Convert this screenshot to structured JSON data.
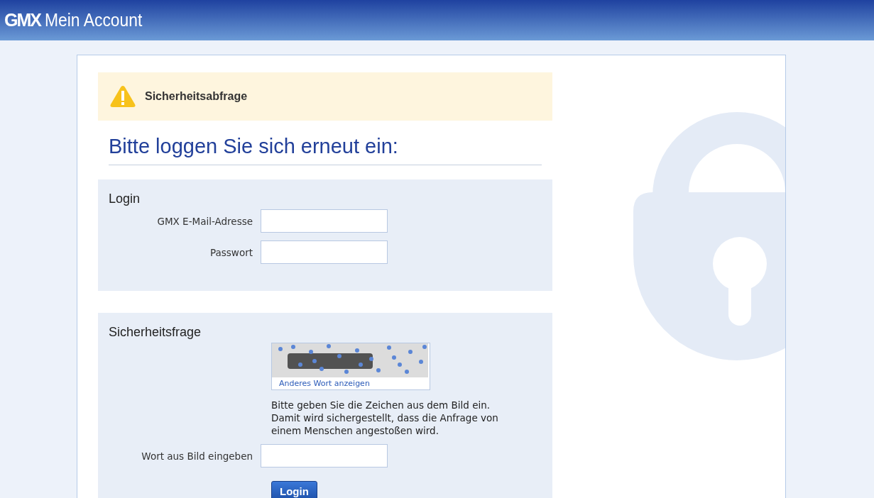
{
  "header": {
    "logo": "GMX",
    "title": "Mein Account"
  },
  "alert": {
    "title": "Sicherheitsabfrage"
  },
  "heading": "Bitte loggen Sie sich erneut ein:",
  "login_section": {
    "title": "Login",
    "fields": [
      {
        "label": "GMX E-Mail-Adresse"
      },
      {
        "label": "Passwort"
      }
    ]
  },
  "security_section": {
    "title": "Sicherheitsfrage",
    "captcha_link": "Anderes Wort anzeigen",
    "instruction_lines": [
      "Bitte geben Sie die Zeichen aus dem Bild ein.",
      "Damit wird sichergestellt, dass die Anfrage von",
      "einem Menschen angestoßen wird."
    ],
    "field": {
      "label": "Wort aus Bild eingeben"
    },
    "button": "Login"
  }
}
